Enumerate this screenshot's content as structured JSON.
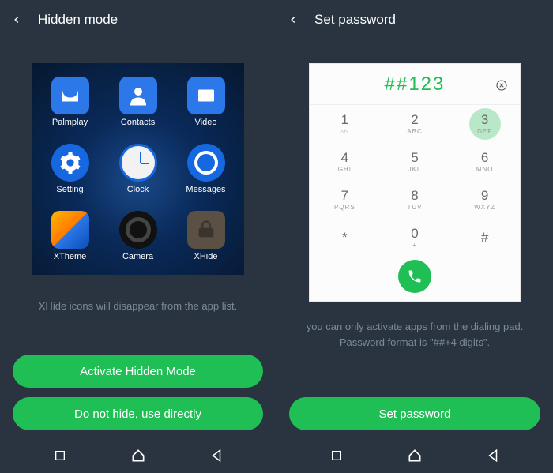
{
  "left": {
    "title": "Hidden mode",
    "apps": [
      {
        "label": "Palmplay",
        "icon": "palmplay"
      },
      {
        "label": "Contacts",
        "icon": "contacts"
      },
      {
        "label": "Video",
        "icon": "video"
      },
      {
        "label": "Setting",
        "icon": "setting"
      },
      {
        "label": "Clock",
        "icon": "clock"
      },
      {
        "label": "Messages",
        "icon": "messages"
      },
      {
        "label": "XTheme",
        "icon": "xtheme"
      },
      {
        "label": "Camera",
        "icon": "camera"
      },
      {
        "label": "XHide",
        "icon": "xhide"
      }
    ],
    "hint": "XHide icons will disappear from the app list.",
    "btn1": "Activate Hidden Mode",
    "btn2": "Do not hide, use directly"
  },
  "right": {
    "title": "Set password",
    "display": "##123",
    "keys": [
      {
        "n": "1",
        "s": "ಯ"
      },
      {
        "n": "2",
        "s": "ABC"
      },
      {
        "n": "3",
        "s": "DEF",
        "hl": true
      },
      {
        "n": "4",
        "s": "GHI"
      },
      {
        "n": "5",
        "s": "JKL"
      },
      {
        "n": "6",
        "s": "MNO"
      },
      {
        "n": "7",
        "s": "PQRS"
      },
      {
        "n": "8",
        "s": "TUV"
      },
      {
        "n": "9",
        "s": "WXYZ"
      },
      {
        "n": "*",
        "s": ""
      },
      {
        "n": "0",
        "s": "+"
      },
      {
        "n": "#",
        "s": ""
      }
    ],
    "hint": "you can only activate apps from the dialing pad. Password format is \"##+4 digits\".",
    "btn": "Set password"
  },
  "colors": {
    "bg": "#2a3441",
    "accent": "#1fbf55",
    "muted": "#7d8a97"
  }
}
